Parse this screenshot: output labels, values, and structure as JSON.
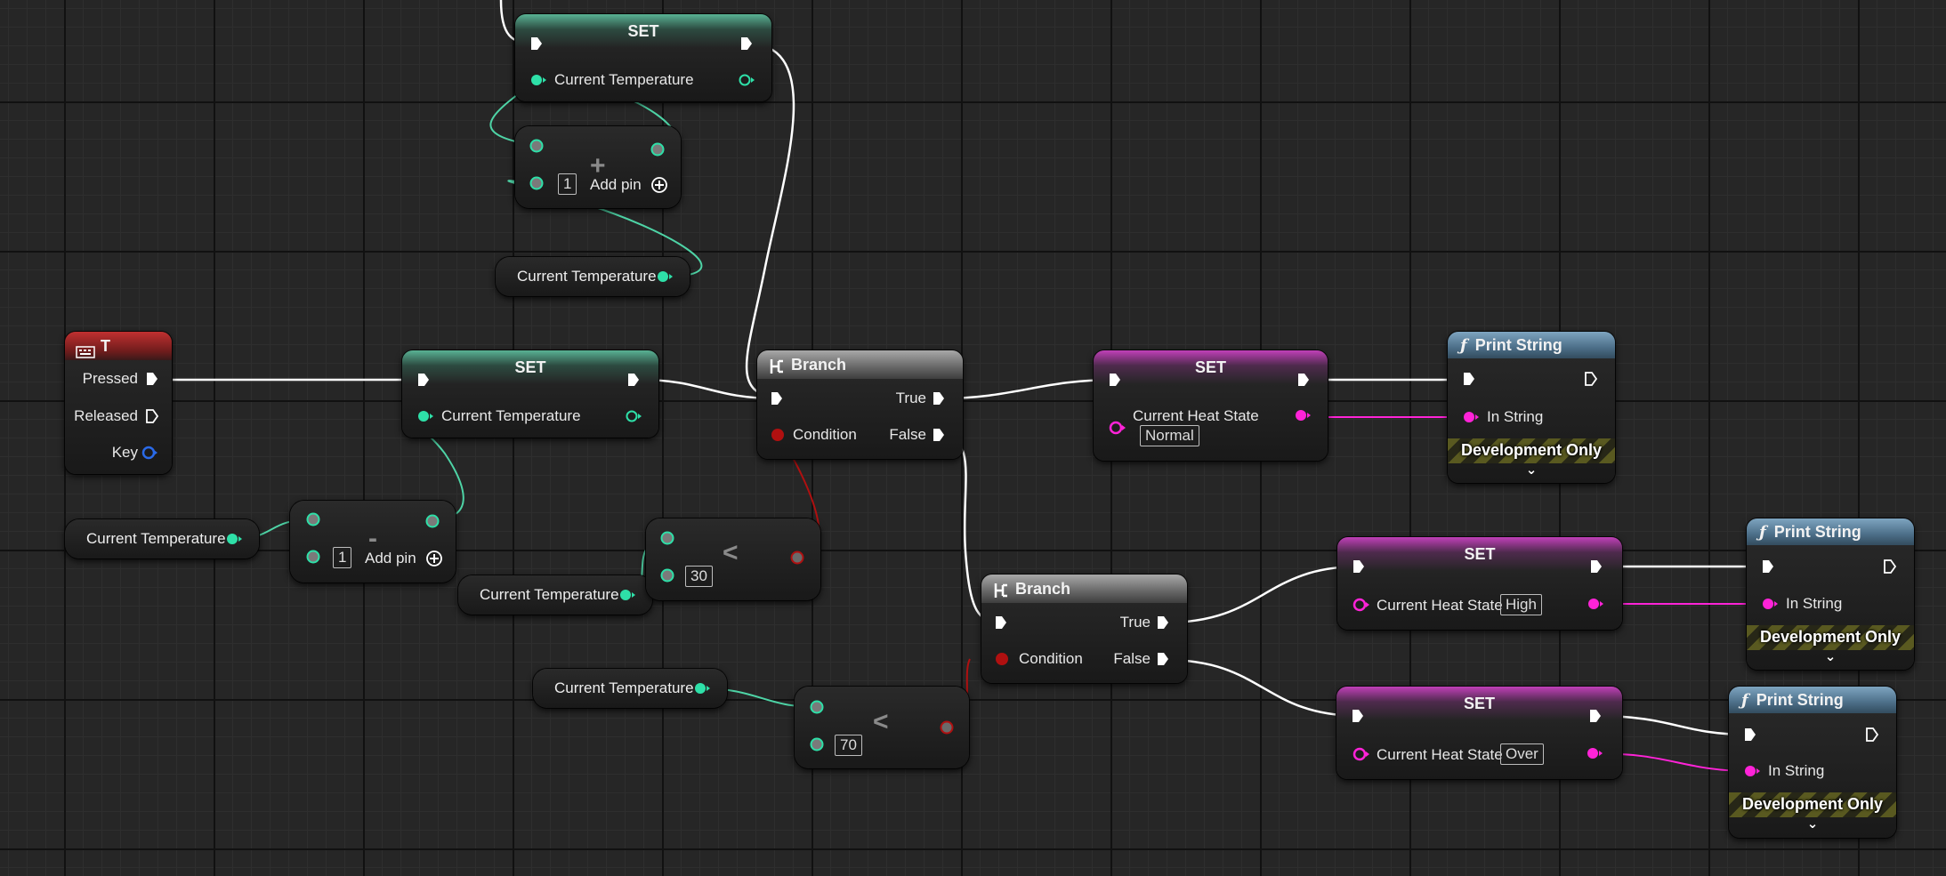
{
  "colors": {
    "exec": "#ffffff",
    "float_pin": "#2ee0a8",
    "float_wire": "#4ed4a6",
    "string_pin": "#ff23d8",
    "bool_pin": "#b01010",
    "struct_pin": "#2a6ae8",
    "set_var_header": "#59b294",
    "set_string_header": "#c040b8",
    "function_header": "#6e94b0"
  },
  "input_event": {
    "title": "T",
    "icon": "keyboard-icon",
    "pins": [
      "Pressed",
      "Released",
      "Key"
    ]
  },
  "set_top": {
    "title": "SET",
    "var": "Current Temperature"
  },
  "add_node": {
    "symbol": "+",
    "literal": "1",
    "add_pin_label": "Add pin"
  },
  "getter_top": {
    "label": "Current Temperature"
  },
  "set_mid": {
    "title": "SET",
    "var": "Current Temperature"
  },
  "getter_left": {
    "label": "Current Temperature"
  },
  "sub_node": {
    "symbol": "-",
    "literal": "1",
    "add_pin_label": "Add pin"
  },
  "getter_lt30": {
    "label": "Current Temperature"
  },
  "lt30": {
    "literal": "30",
    "symbol": "<"
  },
  "getter_lt70": {
    "label": "Current Temperature"
  },
  "lt70": {
    "literal": "70",
    "symbol": "<"
  },
  "branch1": {
    "title": "Branch",
    "icon": "branch-icon",
    "true_label": "True",
    "false_label": "False",
    "condition_label": "Condition"
  },
  "branch2": {
    "title": "Branch",
    "icon": "branch-icon",
    "true_label": "True",
    "false_label": "False",
    "condition_label": "Condition"
  },
  "set_normal": {
    "title": "SET",
    "var": "Current Heat State",
    "value": "Normal"
  },
  "set_high": {
    "title": "SET",
    "var": "Current Heat State",
    "value": "High"
  },
  "set_over": {
    "title": "SET",
    "var": "Current Heat State",
    "value": "Over"
  },
  "print1": {
    "title": "Print String",
    "icon": "function-icon",
    "in_string": "In String",
    "dev_only": "Development Only"
  },
  "print2": {
    "title": "Print String",
    "icon": "function-icon",
    "in_string": "In String",
    "dev_only": "Development Only"
  },
  "print3": {
    "title": "Print String",
    "icon": "function-icon",
    "in_string": "In String",
    "dev_only": "Development Only"
  }
}
